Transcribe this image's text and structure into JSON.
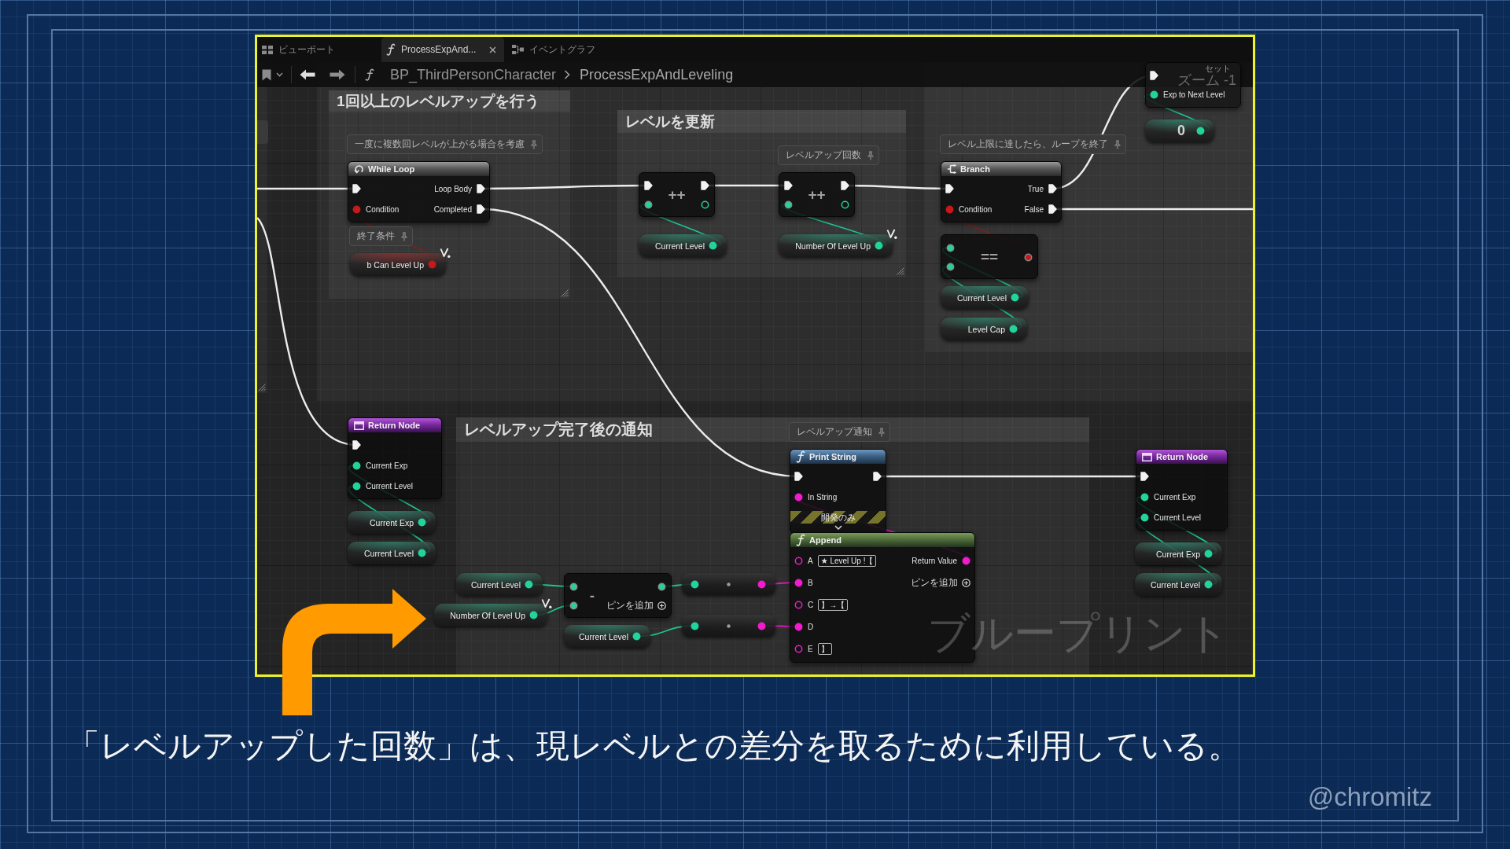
{
  "editor": {
    "tabs": [
      {
        "label": "ビューポート",
        "selected": false
      },
      {
        "label": "ProcessExpAnd...",
        "selected": true
      },
      {
        "label": "イベントグラフ",
        "selected": false
      }
    ],
    "breadcrumb": [
      "BP_ThirdPersonCharacter",
      "ProcessExpAndLeveling"
    ],
    "graph": {
      "comments": [
        {
          "title": "1回以上のレベルアップを行う"
        },
        {
          "title": "レベルを更新"
        },
        {
          "title": "レベルアップ完了後の通知"
        }
      ],
      "nodes": [
        {
          "kind": "macro",
          "title": "While Loop",
          "comment": "一度に複数回レベルが上がる場合を考慮",
          "inputs": [
            {
              "kind": "exec",
              "connected": true
            },
            {
              "kind": "bool",
              "label": "Condition",
              "connected": true
            }
          ],
          "outputs": [
            {
              "kind": "exec",
              "label": "Loop Body",
              "connected": true
            },
            {
              "kind": "exec",
              "label": "Completed",
              "connected": true
            }
          ]
        },
        {
          "kind": "variable",
          "label": "b Can Level Up",
          "marker": true,
          "comment": "終了条件",
          "outputs": [
            {
              "kind": "bool",
              "connected": true
            }
          ]
        },
        {
          "kind": "operator",
          "symbol": "++",
          "inputs": [
            {
              "kind": "exec",
              "connected": true
            },
            {
              "kind": "int",
              "connected": true
            }
          ],
          "outputs": [
            {
              "kind": "exec",
              "connected": true
            },
            {
              "kind": "int",
              "connected": false
            }
          ]
        },
        {
          "kind": "variable",
          "label": "Current Level",
          "marker": false,
          "outputs": [
            {
              "kind": "int",
              "connected": true
            }
          ]
        },
        {
          "kind": "operator",
          "symbol": "++",
          "comment": "レベルアップ回数",
          "inputs": [
            {
              "kind": "exec",
              "connected": true
            },
            {
              "kind": "int",
              "connected": true
            }
          ],
          "outputs": [
            {
              "kind": "exec",
              "connected": true
            },
            {
              "kind": "int",
              "connected": false
            }
          ]
        },
        {
          "kind": "variable",
          "label": "Number Of Level Up",
          "marker": true,
          "outputs": [
            {
              "kind": "int",
              "connected": true
            }
          ]
        },
        {
          "kind": "flow",
          "title": "Branch",
          "comment": "レベル上限に達したら、ループを終了",
          "inputs": [
            {
              "kind": "exec",
              "connected": true
            },
            {
              "kind": "bool",
              "label": "Condition",
              "connected": true
            }
          ],
          "outputs": [
            {
              "kind": "exec",
              "label": "True",
              "connected": true
            },
            {
              "kind": "exec",
              "label": "False",
              "connected": true
            }
          ]
        },
        {
          "kind": "operator",
          "symbol": "==",
          "inputs": [
            {
              "kind": "int",
              "connected": true
            },
            {
              "kind": "int",
              "connected": true
            }
          ],
          "outputs": [
            {
              "kind": "bool",
              "connected": true
            }
          ]
        },
        {
          "kind": "variable",
          "label": "Current Level",
          "marker": false,
          "outputs": [
            {
              "kind": "int",
              "connected": true
            }
          ]
        },
        {
          "kind": "variable",
          "label": "Level Cap",
          "marker": false,
          "outputs": [
            {
              "kind": "int",
              "connected": true
            }
          ]
        },
        {
          "kind": "set",
          "title": "セット",
          "inputs": [
            {
              "kind": "exec",
              "connected": true
            },
            {
              "kind": "int",
              "label": "Exp to Next Level",
              "connected": true
            }
          ]
        },
        {
          "kind": "literal",
          "value": "0",
          "outputs": [
            {
              "kind": "int",
              "connected": true
            }
          ]
        },
        {
          "kind": "result",
          "title": "Return Node",
          "inputs": [
            {
              "kind": "exec",
              "connected": true
            },
            {
              "kind": "int",
              "label": "Current Exp",
              "connected": true
            },
            {
              "kind": "int",
              "label": "Current Level",
              "connected": true
            }
          ]
        },
        {
          "kind": "variable",
          "label": "Current Exp",
          "marker": false,
          "outputs": [
            {
              "kind": "int",
              "connected": true
            }
          ]
        },
        {
          "kind": "variable",
          "label": "Current Level",
          "marker": false,
          "outputs": [
            {
              "kind": "int",
              "connected": true
            }
          ]
        },
        {
          "kind": "variable",
          "label": "Current Level",
          "marker": false,
          "outputs": [
            {
              "kind": "int",
              "connected": true
            }
          ]
        },
        {
          "kind": "variable",
          "label": "Number Of Level Up",
          "marker": true,
          "outputs": [
            {
              "kind": "int",
              "connected": true
            }
          ]
        },
        {
          "kind": "operator",
          "symbol": "-",
          "add_pin_label": "ピンを追加",
          "inputs": [
            {
              "kind": "int",
              "connected": true
            },
            {
              "kind": "int",
              "connected": true
            }
          ],
          "outputs": [
            {
              "kind": "int",
              "connected": true
            }
          ]
        },
        {
          "kind": "variable",
          "label": "Current Level",
          "marker": false,
          "outputs": [
            {
              "kind": "int",
              "connected": true
            }
          ]
        },
        {
          "kind": "conversion",
          "inputs": [
            {
              "kind": "int",
              "connected": true
            }
          ],
          "outputs": [
            {
              "kind": "string",
              "connected": true
            }
          ]
        },
        {
          "kind": "conversion",
          "inputs": [
            {
              "kind": "int",
              "connected": true
            }
          ],
          "outputs": [
            {
              "kind": "string",
              "connected": true
            }
          ]
        },
        {
          "kind": "function",
          "title": "Print String",
          "comment": "レベルアップ通知",
          "dev_only_label": "開発のみ",
          "advanced_expanded": false,
          "inputs": [
            {
              "kind": "exec",
              "connected": true
            },
            {
              "kind": "string",
              "label": "In String",
              "connected": true
            }
          ],
          "outputs": [
            {
              "kind": "exec",
              "connected": true
            }
          ]
        },
        {
          "kind": "pure_function",
          "title": "Append",
          "add_pin_label": "ピンを追加",
          "inputs": [
            {
              "kind": "string",
              "label": "A",
              "default": "★ Level Up !【",
              "connected": false
            },
            {
              "kind": "string",
              "label": "B",
              "connected": true
            },
            {
              "kind": "string",
              "label": "C",
              "default": "】→【",
              "connected": false
            },
            {
              "kind": "string",
              "label": "D",
              "connected": true
            },
            {
              "kind": "string",
              "label": "E",
              "default": "】",
              "connected": false
            }
          ],
          "outputs": [
            {
              "kind": "string",
              "label": "Return Value",
              "connected": true
            }
          ]
        },
        {
          "kind": "result",
          "title": "Return Node",
          "inputs": [
            {
              "kind": "exec",
              "connected": true
            },
            {
              "kind": "int",
              "label": "Current Exp",
              "connected": true
            },
            {
              "kind": "int",
              "label": "Current Level",
              "connected": true
            }
          ]
        },
        {
          "kind": "variable",
          "label": "Current Exp",
          "marker": false,
          "outputs": [
            {
              "kind": "int",
              "connected": true
            }
          ]
        },
        {
          "kind": "variable",
          "label": "Current Level",
          "marker": false,
          "outputs": [
            {
              "kind": "int",
              "connected": true
            }
          ]
        }
      ],
      "zoom_label": "ズーム -1",
      "graph_type_label": "ブループリント"
    }
  },
  "caption": "「レベルアップした回数」は、現レベルとの差分を取るために利用している。",
  "credit": "@chromitz"
}
